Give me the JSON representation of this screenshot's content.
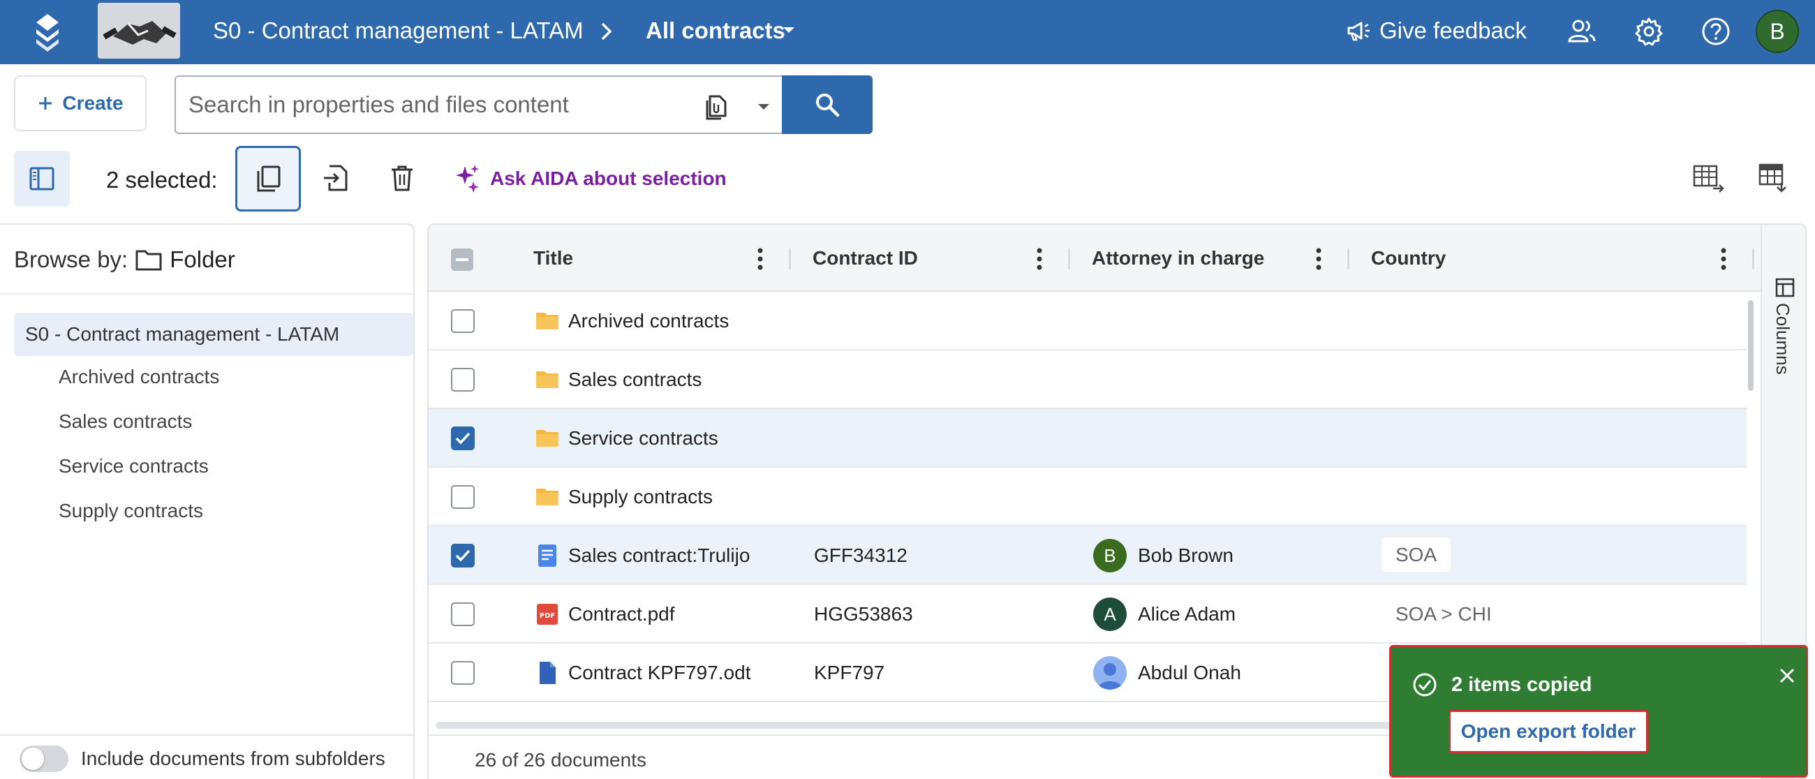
{
  "topbar": {
    "workspace_name": "S0 - Contract management - LATAM",
    "view_name": "All contracts",
    "feedback_label": "Give feedback",
    "user_initial": "B",
    "bg_color": "#2e68ad"
  },
  "search": {
    "create_label": "Create",
    "placeholder": "Search in properties and files content"
  },
  "selection": {
    "count_label": "2 selected:",
    "aida_label": "Ask AIDA about selection"
  },
  "sidebar": {
    "browse_label": "Browse by:",
    "browse_value": "Folder",
    "root": "S0 - Contract management - LATAM",
    "children": [
      "Archived contracts",
      "Sales contracts",
      "Service contracts",
      "Supply contracts"
    ],
    "subfolders_label": "Include documents from subfolders",
    "subfolders_on": false
  },
  "table": {
    "columns": [
      "Title",
      "Contract ID",
      "Attorney in charge",
      "Country"
    ],
    "rows": [
      {
        "title": "Archived contracts",
        "type": "folder-icon",
        "contract_id": "",
        "attorney": "",
        "country": "",
        "checked": false
      },
      {
        "title": "Sales contracts",
        "type": "folder-icon",
        "contract_id": "",
        "attorney": "",
        "country": "",
        "checked": false
      },
      {
        "title": "Service contracts",
        "type": "folder-icon",
        "contract_id": "",
        "attorney": "",
        "country": "",
        "checked": true
      },
      {
        "title": "Supply contracts",
        "type": "folder-icon",
        "contract_id": "",
        "attorney": "",
        "country": "",
        "checked": false
      },
      {
        "title": "Sales contract:Trulijo",
        "type": "doc-icon",
        "contract_id": "GFF34312",
        "attorney": "Bob Brown",
        "attorney_initial": "B",
        "attorney_color": "#3b6b1e",
        "country": "SOA",
        "checked": true
      },
      {
        "title": "Contract.pdf",
        "type": "pdf-icon",
        "contract_id": "HGG53863",
        "attorney": "Alice Adam",
        "attorney_initial": "A",
        "attorney_color": "#1e4d3a",
        "country": "SOA > CHI",
        "checked": false
      },
      {
        "title": "Contract KPF797.odt",
        "type": "file-icon",
        "contract_id": "KPF797",
        "attorney": "Abdul Onah",
        "attorney_initial": "",
        "attorney_color": "#8fb3f0",
        "country": "",
        "checked": false
      }
    ],
    "footer": "26 of 26 documents",
    "columns_panel_label": "Columns"
  },
  "toast": {
    "message": "2 items copied",
    "action_label": "Open export folder",
    "bg_color": "#2e7d32"
  }
}
